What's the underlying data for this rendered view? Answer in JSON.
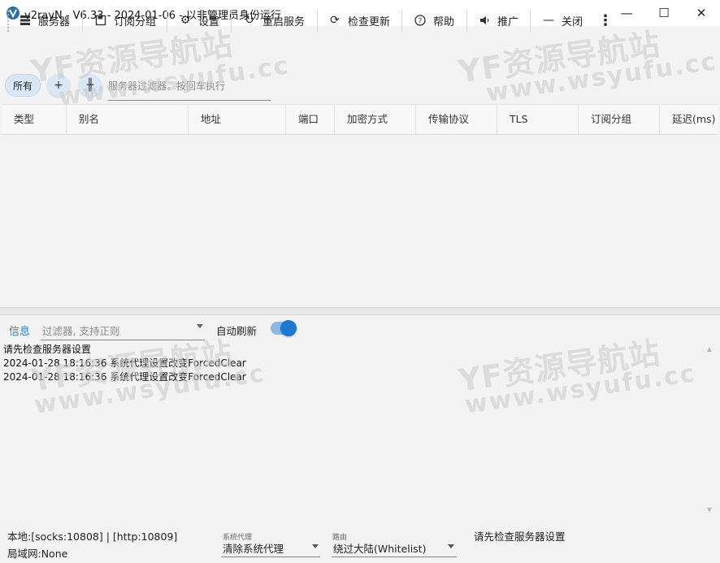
{
  "window": {
    "title": "v2rayN - V6.33 - 2024-01-06 - 以非管理员身份运行",
    "controls": {
      "minimize": "—",
      "maximize": "☐",
      "close": "✕"
    }
  },
  "toolbar": {
    "items": [
      {
        "label": "服务器",
        "icon": "server-icon"
      },
      {
        "label": "订阅分组",
        "icon": "subscription-icon"
      },
      {
        "label": "设置",
        "icon": "gear-icon"
      },
      {
        "label": "重启服务",
        "icon": "restart-icon"
      },
      {
        "label": "检查更新",
        "icon": "refresh-icon"
      },
      {
        "label": "帮助",
        "icon": "help-icon"
      },
      {
        "label": "推广",
        "icon": "speaker-icon"
      },
      {
        "label": "关闭",
        "icon": "minus-icon"
      }
    ],
    "more": "⋮"
  },
  "filter_row": {
    "all_chip": "所有",
    "add_button": "+",
    "edit_button": "╫",
    "server_filter_placeholder": "服务器过滤器，按回车执行"
  },
  "table": {
    "columns": [
      "类型",
      "别名",
      "地址",
      "端口",
      "加密方式",
      "传输协议",
      "TLS",
      "订阅分组",
      "延迟(ms)"
    ]
  },
  "log_panel": {
    "tab_label": "信息",
    "filter_placeholder": "过滤器, 支持正则",
    "auto_refresh_label": "自动刷新",
    "auto_refresh_on": true,
    "lines": [
      "请先检查服务器设置",
      "2024-01-28 18:16:36 系统代理设置改变ForcedClear",
      "2024-01-28 18:16:36 系统代理设置改变ForcedClear"
    ]
  },
  "status_bar": {
    "local_ports": "本地:[socks:10808] | [http:10809]",
    "lan": "局域网:None",
    "system_proxy_label": "系统代理",
    "system_proxy_value": "清除系统代理",
    "routing_label": "路由",
    "routing_value": "绕过大陆(Whitelist)",
    "message": "请先检查服务器设置"
  },
  "watermark": {
    "brand": "YF资源导航站",
    "url": "www.wsyufu.cc"
  },
  "colors": {
    "accent": "#1e79d6",
    "window_bg": "#f3f3f3",
    "chip_bg": "#d9e7f6"
  }
}
